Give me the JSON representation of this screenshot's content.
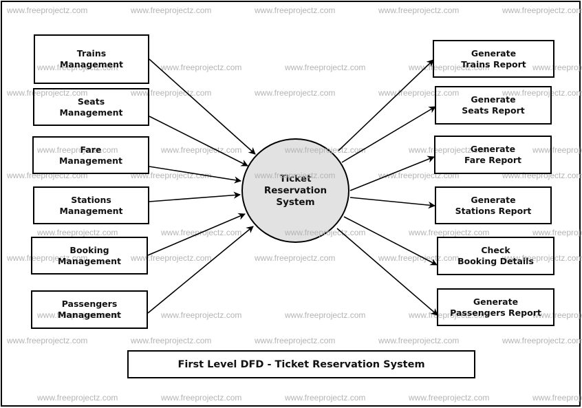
{
  "diagram": {
    "type": "data-flow-diagram",
    "level": "first-level",
    "title": "First Level DFD - Ticket Reservation System",
    "central_process": {
      "id": "process",
      "lines": [
        "Ticket",
        "Reservation",
        "System"
      ]
    },
    "inputs": [
      {
        "id": "trains-management",
        "lines": [
          "Trains",
          "Management"
        ]
      },
      {
        "id": "seats-management",
        "lines": [
          "Seats",
          "Management"
        ]
      },
      {
        "id": "fare-management",
        "lines": [
          "Fare",
          "Management"
        ]
      },
      {
        "id": "stations-management",
        "lines": [
          "Stations",
          "Management"
        ]
      },
      {
        "id": "booking-management",
        "lines": [
          "Booking",
          "Management"
        ]
      },
      {
        "id": "passengers-management",
        "lines": [
          "Passengers",
          "Management"
        ]
      }
    ],
    "outputs": [
      {
        "id": "generate-trains-report",
        "lines": [
          "Generate",
          "Trains Report"
        ]
      },
      {
        "id": "generate-seats-report",
        "lines": [
          "Generate",
          "Seats Report"
        ]
      },
      {
        "id": "generate-fare-report",
        "lines": [
          "Generate",
          "Fare Report"
        ]
      },
      {
        "id": "generate-stations-report",
        "lines": [
          "Generate",
          "Stations Report"
        ]
      },
      {
        "id": "check-booking-details",
        "lines": [
          "Check",
          "Booking Details"
        ]
      },
      {
        "id": "generate-passengers-report",
        "lines": [
          "Generate",
          "Passengers Report"
        ]
      }
    ],
    "flows": [
      {
        "from": "trains-management",
        "to": "process"
      },
      {
        "from": "seats-management",
        "to": "process"
      },
      {
        "from": "fare-management",
        "to": "process"
      },
      {
        "from": "stations-management",
        "to": "process"
      },
      {
        "from": "booking-management",
        "to": "process"
      },
      {
        "from": "passengers-management",
        "to": "process"
      },
      {
        "from": "process",
        "to": "generate-trains-report"
      },
      {
        "from": "process",
        "to": "generate-seats-report"
      },
      {
        "from": "process",
        "to": "generate-fare-report"
      },
      {
        "from": "process",
        "to": "generate-stations-report"
      },
      {
        "from": "process",
        "to": "check-booking-details"
      },
      {
        "from": "process",
        "to": "generate-passengers-report"
      }
    ]
  },
  "watermark": {
    "text": "www.freeprojectz.com",
    "color": "#b4b4b4"
  },
  "colors": {
    "process_fill": "#e2e2e2",
    "stroke": "#000000",
    "background": "#ffffff"
  }
}
